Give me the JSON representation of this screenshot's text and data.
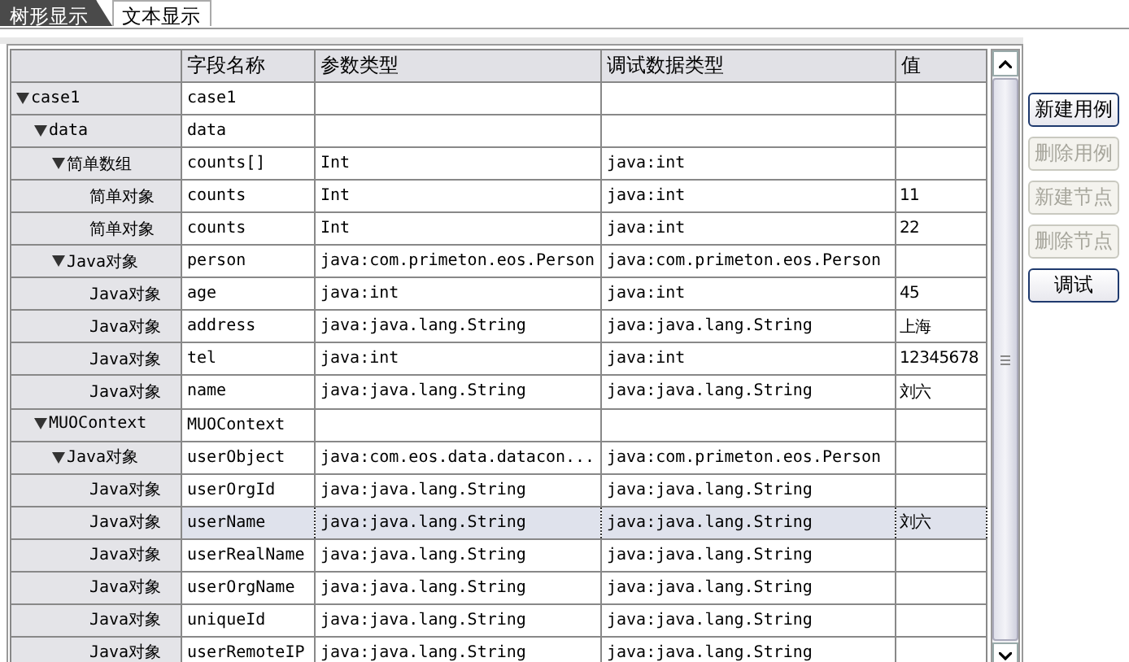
{
  "tabs": [
    {
      "label": "树形显示",
      "selected": true
    },
    {
      "label": "文本显示",
      "selected": false
    }
  ],
  "table": {
    "columns": [
      "字段名称",
      "参数类型",
      "调试数据类型",
      "值"
    ],
    "tree": [
      {
        "label": "case1",
        "expanded": true,
        "selected": false,
        "field": "case1",
        "children": [
          {
            "label": "data",
            "expanded": true,
            "selected": false,
            "field": "data",
            "children": [
              {
                "label": "简单数组",
                "expanded": true,
                "selected": false,
                "field": "counts[]",
                "param_type": "Int",
                "debug_type": "java:int",
                "children": [
                  {
                    "label": "简单对象",
                    "selected": false,
                    "field": "counts",
                    "param_type": "Int",
                    "debug_type": "java:int",
                    "value": "11"
                  },
                  {
                    "label": "简单对象",
                    "selected": false,
                    "field": "counts",
                    "param_type": "Int",
                    "debug_type": "java:int",
                    "value": "22"
                  }
                ]
              },
              {
                "label": "Java对象",
                "expanded": true,
                "selected": false,
                "field": "person",
                "param_type": "java:com.primeton.eos.Person",
                "debug_type": "java:com.primeton.eos.Person",
                "children": [
                  {
                    "label": "Java对象",
                    "selected": false,
                    "field": "age",
                    "param_type": "java:int",
                    "debug_type": "java:int",
                    "value": "45"
                  },
                  {
                    "label": "Java对象",
                    "selected": false,
                    "field": "address",
                    "param_type": "java:java.lang.String",
                    "debug_type": "java:java.lang.String",
                    "value": "上海"
                  },
                  {
                    "label": "Java对象",
                    "selected": false,
                    "field": "tel",
                    "param_type": "java:int",
                    "debug_type": "java:int",
                    "value": "12345678"
                  },
                  {
                    "label": "Java对象",
                    "selected": false,
                    "field": "name",
                    "param_type": "java:java.lang.String",
                    "debug_type": "java:java.lang.String",
                    "value": "刘六"
                  }
                ]
              }
            ]
          },
          {
            "label": "MUOContext",
            "expanded": true,
            "selected": false,
            "field": "MUOContext",
            "children": [
              {
                "label": "Java对象",
                "expanded": true,
                "selected": false,
                "field": "userObject",
                "param_type": "java:com.eos.data.datacon...",
                "debug_type": "java:com.primeton.eos.Person",
                "children": [
                  {
                    "label": "Java对象",
                    "selected": false,
                    "field": "userOrgId",
                    "param_type": "java:java.lang.String",
                    "debug_type": "java:java.lang.String"
                  },
                  {
                    "label": "Java对象",
                    "selected": true,
                    "field": "userName",
                    "param_type": "java:java.lang.String",
                    "debug_type": "java:java.lang.String",
                    "value": "刘六"
                  },
                  {
                    "label": "Java对象",
                    "selected": false,
                    "field": "userRealName",
                    "param_type": "java:java.lang.String",
                    "debug_type": "java:java.lang.String"
                  },
                  {
                    "label": "Java对象",
                    "selected": false,
                    "field": "userOrgName",
                    "param_type": "java:java.lang.String",
                    "debug_type": "java:java.lang.String"
                  },
                  {
                    "label": "Java对象",
                    "selected": false,
                    "field": "uniqueId",
                    "param_type": "java:java.lang.String",
                    "debug_type": "java:java.lang.String"
                  },
                  {
                    "label": "Java对象",
                    "selected": false,
                    "field": "userRemoteIP",
                    "param_type": "java:java.lang.String",
                    "debug_type": "java:java.lang.String"
                  }
                ]
              }
            ]
          }
        ]
      }
    ]
  },
  "buttons": [
    {
      "label": "新建用例",
      "disabled": false
    },
    {
      "label": "删除用例",
      "disabled": true
    },
    {
      "label": "新建节点",
      "disabled": true
    },
    {
      "label": "删除节点",
      "disabled": true
    },
    {
      "label": "调试",
      "disabled": false
    }
  ]
}
